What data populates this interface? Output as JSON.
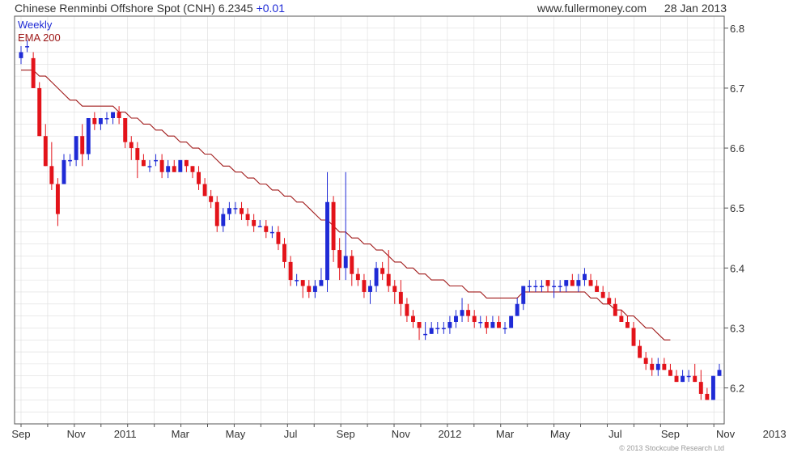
{
  "header": {
    "title": "Chinese Renminbi Offshore Spot (CNH)",
    "last": "6.2345",
    "change": "+0.01",
    "site": "www.fullermoney.com",
    "date": "28 Jan 2013"
  },
  "footer": {
    "copyright": "© 2013 Stockcube Research Ltd"
  },
  "colors": {
    "up": "#1f2bd6",
    "down": "#e3131a",
    "ema": "#a01a1a",
    "grid": "#dddddd",
    "axis": "#555555",
    "weekly_label": "#1f2bd6"
  },
  "chart_data": {
    "type": "candlestick",
    "indicators": [
      "Weekly",
      "EMA 200"
    ],
    "grid": true,
    "ylim": [
      6.14,
      6.82
    ],
    "yticks": [
      6.2,
      6.3,
      6.4,
      6.5,
      6.6,
      6.7,
      6.8
    ],
    "x_tick_labels": [
      "Sep",
      "Nov",
      "2011",
      "Mar",
      "May",
      "Jul",
      "Sep",
      "Nov",
      "2012",
      "Mar",
      "May",
      "Jul",
      "Sep",
      "Nov",
      "2013"
    ],
    "x_tick_weeks": [
      0,
      9,
      17,
      26,
      35,
      44,
      53,
      62,
      70,
      79,
      88,
      97,
      106,
      115,
      123
    ],
    "series": [
      {
        "name": "Weekly",
        "ohlc": [
          [
            6.75,
            6.77,
            6.74,
            6.76
          ],
          [
            6.77,
            6.78,
            6.76,
            6.77
          ],
          [
            6.75,
            6.76,
            6.7,
            6.7
          ],
          [
            6.7,
            6.71,
            6.62,
            6.62
          ],
          [
            6.62,
            6.64,
            6.57,
            6.57
          ],
          [
            6.57,
            6.61,
            6.53,
            6.54
          ],
          [
            6.54,
            6.55,
            6.47,
            6.49
          ],
          [
            6.54,
            6.59,
            6.54,
            6.58
          ],
          [
            6.58,
            6.59,
            6.57,
            6.58
          ],
          [
            6.58,
            6.62,
            6.57,
            6.62
          ],
          [
            6.62,
            6.64,
            6.57,
            6.59
          ],
          [
            6.59,
            6.65,
            6.58,
            6.65
          ],
          [
            6.65,
            6.66,
            6.63,
            6.64
          ],
          [
            6.64,
            6.65,
            6.63,
            6.65
          ],
          [
            6.65,
            6.66,
            6.64,
            6.65
          ],
          [
            6.65,
            6.66,
            6.64,
            6.66
          ],
          [
            6.66,
            6.67,
            6.64,
            6.65
          ],
          [
            6.65,
            6.65,
            6.6,
            6.61
          ],
          [
            6.61,
            6.62,
            6.58,
            6.6
          ],
          [
            6.6,
            6.61,
            6.55,
            6.58
          ],
          [
            6.58,
            6.59,
            6.57,
            6.57
          ],
          [
            6.57,
            6.58,
            6.56,
            6.57
          ],
          [
            6.58,
            6.59,
            6.57,
            6.58
          ],
          [
            6.58,
            6.59,
            6.55,
            6.56
          ],
          [
            6.56,
            6.58,
            6.55,
            6.57
          ],
          [
            6.57,
            6.58,
            6.56,
            6.56
          ],
          [
            6.56,
            6.58,
            6.56,
            6.58
          ],
          [
            6.58,
            6.58,
            6.56,
            6.57
          ],
          [
            6.57,
            6.57,
            6.55,
            6.56
          ],
          [
            6.56,
            6.57,
            6.53,
            6.54
          ],
          [
            6.54,
            6.55,
            6.52,
            6.52
          ],
          [
            6.52,
            6.53,
            6.5,
            6.51
          ],
          [
            6.51,
            6.52,
            6.46,
            6.47
          ],
          [
            6.47,
            6.5,
            6.46,
            6.49
          ],
          [
            6.49,
            6.51,
            6.48,
            6.5
          ],
          [
            6.5,
            6.51,
            6.49,
            6.5
          ],
          [
            6.5,
            6.51,
            6.48,
            6.49
          ],
          [
            6.49,
            6.5,
            6.47,
            6.48
          ],
          [
            6.48,
            6.49,
            6.46,
            6.47
          ],
          [
            6.47,
            6.48,
            6.47,
            6.47
          ],
          [
            6.47,
            6.48,
            6.45,
            6.46
          ],
          [
            6.46,
            6.47,
            6.45,
            6.46
          ],
          [
            6.46,
            6.47,
            6.43,
            6.44
          ],
          [
            6.44,
            6.45,
            6.4,
            6.41
          ],
          [
            6.41,
            6.42,
            6.37,
            6.38
          ],
          [
            6.38,
            6.39,
            6.37,
            6.38
          ],
          [
            6.38,
            6.38,
            6.35,
            6.37
          ],
          [
            6.37,
            6.38,
            6.35,
            6.36
          ],
          [
            6.36,
            6.38,
            6.35,
            6.37
          ],
          [
            6.37,
            6.4,
            6.37,
            6.38
          ],
          [
            6.38,
            6.56,
            6.36,
            6.51
          ],
          [
            6.51,
            6.52,
            6.41,
            6.43
          ],
          [
            6.43,
            6.45,
            6.38,
            6.4
          ],
          [
            6.4,
            6.56,
            6.38,
            6.42
          ],
          [
            6.42,
            6.43,
            6.37,
            6.39
          ],
          [
            6.39,
            6.4,
            6.37,
            6.38
          ],
          [
            6.38,
            6.39,
            6.35,
            6.36
          ],
          [
            6.36,
            6.38,
            6.34,
            6.37
          ],
          [
            6.37,
            6.41,
            6.36,
            6.4
          ],
          [
            6.4,
            6.41,
            6.38,
            6.39
          ],
          [
            6.39,
            6.43,
            6.36,
            6.37
          ],
          [
            6.37,
            6.38,
            6.34,
            6.36
          ],
          [
            6.36,
            6.38,
            6.32,
            6.34
          ],
          [
            6.34,
            6.35,
            6.31,
            6.32
          ],
          [
            6.32,
            6.33,
            6.3,
            6.31
          ],
          [
            6.31,
            6.31,
            6.28,
            6.3
          ],
          [
            6.29,
            6.31,
            6.28,
            6.29
          ],
          [
            6.29,
            6.31,
            6.29,
            6.3
          ],
          [
            6.3,
            6.31,
            6.29,
            6.3
          ],
          [
            6.3,
            6.31,
            6.29,
            6.3
          ],
          [
            6.3,
            6.32,
            6.29,
            6.31
          ],
          [
            6.31,
            6.33,
            6.3,
            6.32
          ],
          [
            6.32,
            6.35,
            6.31,
            6.33
          ],
          [
            6.33,
            6.34,
            6.31,
            6.32
          ],
          [
            6.32,
            6.33,
            6.3,
            6.31
          ],
          [
            6.31,
            6.32,
            6.3,
            6.31
          ],
          [
            6.31,
            6.32,
            6.29,
            6.3
          ],
          [
            6.3,
            6.32,
            6.3,
            6.31
          ],
          [
            6.31,
            6.32,
            6.3,
            6.3
          ],
          [
            6.3,
            6.31,
            6.29,
            6.3
          ],
          [
            6.3,
            6.32,
            6.3,
            6.32
          ],
          [
            6.32,
            6.35,
            6.32,
            6.34
          ],
          [
            6.34,
            6.37,
            6.33,
            6.37
          ],
          [
            6.37,
            6.38,
            6.36,
            6.37
          ],
          [
            6.37,
            6.38,
            6.36,
            6.37
          ],
          [
            6.37,
            6.38,
            6.36,
            6.37
          ],
          [
            6.38,
            6.38,
            6.36,
            6.37
          ],
          [
            6.37,
            6.38,
            6.35,
            6.37
          ],
          [
            6.37,
            6.38,
            6.36,
            6.37
          ],
          [
            6.37,
            6.38,
            6.36,
            6.38
          ],
          [
            6.38,
            6.39,
            6.37,
            6.37
          ],
          [
            6.37,
            6.39,
            6.36,
            6.38
          ],
          [
            6.38,
            6.4,
            6.37,
            6.39
          ],
          [
            6.38,
            6.39,
            6.37,
            6.37
          ],
          [
            6.37,
            6.38,
            6.36,
            6.36
          ],
          [
            6.36,
            6.37,
            6.35,
            6.35
          ],
          [
            6.35,
            6.36,
            6.34,
            6.34
          ],
          [
            6.34,
            6.35,
            6.32,
            6.32
          ],
          [
            6.32,
            6.33,
            6.31,
            6.31
          ],
          [
            6.31,
            6.32,
            6.3,
            6.3
          ],
          [
            6.3,
            6.31,
            6.27,
            6.27
          ],
          [
            6.27,
            6.28,
            6.25,
            6.25
          ],
          [
            6.25,
            6.26,
            6.23,
            6.24
          ],
          [
            6.24,
            6.25,
            6.22,
            6.23
          ],
          [
            6.23,
            6.25,
            6.22,
            6.24
          ],
          [
            6.24,
            6.25,
            6.23,
            6.23
          ],
          [
            6.23,
            6.24,
            6.22,
            6.22
          ],
          [
            6.22,
            6.23,
            6.21,
            6.21
          ],
          [
            6.21,
            6.23,
            6.21,
            6.22
          ],
          [
            6.22,
            6.23,
            6.21,
            6.22
          ],
          [
            6.22,
            6.24,
            6.21,
            6.21
          ],
          [
            6.21,
            6.23,
            6.18,
            6.19
          ],
          [
            6.19,
            6.2,
            6.18,
            6.18
          ],
          [
            6.18,
            6.22,
            6.18,
            6.22
          ],
          [
            6.22,
            6.24,
            6.22,
            6.23
          ]
        ]
      },
      {
        "name": "EMA 200",
        "values": [
          6.73,
          6.73,
          6.73,
          6.72,
          6.72,
          6.71,
          6.7,
          6.69,
          6.68,
          6.68,
          6.67,
          6.67,
          6.67,
          6.67,
          6.67,
          6.67,
          6.66,
          6.66,
          6.65,
          6.65,
          6.64,
          6.64,
          6.63,
          6.63,
          6.62,
          6.62,
          6.61,
          6.61,
          6.6,
          6.6,
          6.59,
          6.59,
          6.58,
          6.57,
          6.57,
          6.56,
          6.56,
          6.55,
          6.55,
          6.54,
          6.54,
          6.53,
          6.53,
          6.52,
          6.52,
          6.51,
          6.51,
          6.5,
          6.49,
          6.48,
          6.48,
          6.47,
          6.46,
          6.46,
          6.45,
          6.45,
          6.44,
          6.44,
          6.43,
          6.43,
          6.42,
          6.41,
          6.41,
          6.4,
          6.4,
          6.39,
          6.39,
          6.38,
          6.38,
          6.38,
          6.37,
          6.37,
          6.37,
          6.36,
          6.36,
          6.36,
          6.35,
          6.35,
          6.35,
          6.35,
          6.35,
          6.35,
          6.36,
          6.36,
          6.36,
          6.36,
          6.36,
          6.36,
          6.36,
          6.36,
          6.36,
          6.36,
          6.36,
          6.35,
          6.35,
          6.34,
          6.34,
          6.33,
          6.33,
          6.32,
          6.32,
          6.31,
          6.3,
          6.3,
          6.29,
          6.28,
          6.28
        ]
      }
    ]
  }
}
